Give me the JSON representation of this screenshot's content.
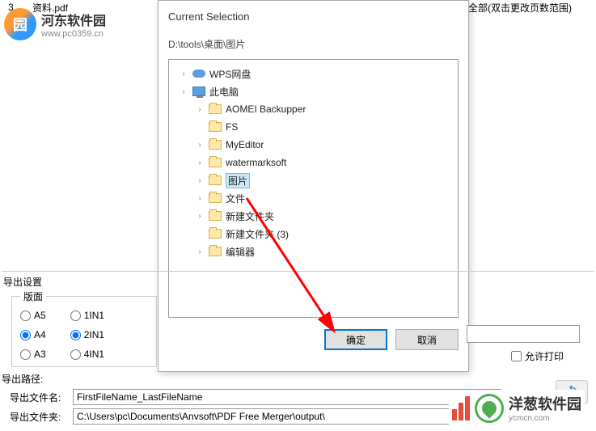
{
  "bgRow": {
    "num": "3",
    "fname": "资料.pdf",
    "range": "全部(双击更改页数范围)"
  },
  "logo1": {
    "title": "河东软件园",
    "url": "www.pc0359.cn"
  },
  "dialog": {
    "title": "Current Selection",
    "path": "D:\\tools\\桌面\\图片",
    "items": [
      {
        "expandable": true,
        "icon": "cloud",
        "label": "WPS网盘",
        "indent": 0
      },
      {
        "expandable": true,
        "icon": "pc",
        "label": "此电脑",
        "indent": 0
      },
      {
        "expandable": true,
        "icon": "folder",
        "label": "AOMEI Backupper",
        "indent": 1
      },
      {
        "expandable": false,
        "icon": "folder",
        "label": "FS",
        "indent": 1
      },
      {
        "expandable": true,
        "icon": "folder",
        "label": "MyEditor",
        "indent": 1
      },
      {
        "expandable": true,
        "icon": "folder",
        "label": "watermarksoft",
        "indent": 1
      },
      {
        "expandable": true,
        "icon": "folder",
        "label": "图片",
        "indent": 1,
        "selected": true
      },
      {
        "expandable": true,
        "icon": "folder",
        "label": "文件",
        "indent": 1
      },
      {
        "expandable": true,
        "icon": "folder",
        "label": "新建文件夹",
        "indent": 1
      },
      {
        "expandable": false,
        "icon": "folder",
        "label": "新建文件夹 (3)",
        "indent": 1
      },
      {
        "expandable": true,
        "icon": "folder",
        "label": "编辑器",
        "indent": 1
      }
    ],
    "okLabel": "确定",
    "cancelLabel": "取消"
  },
  "export": {
    "title": "导出设置",
    "layoutLegend": "版面",
    "radiosCol1": [
      "A5",
      "A4",
      "A3"
    ],
    "radiosCol2": [
      "1IN1",
      "2IN1",
      "4IN1"
    ],
    "selectedCol1": "A4",
    "selectedCol2": "2IN1",
    "allowPrint": "允许打印"
  },
  "paths": {
    "title": "导出路径:",
    "filenameLabel": "导出文件名:",
    "filenameValue": "FirstFileName_LastFileName",
    "folderLabel": "导出文件夹:",
    "folderValue": "C:\\Users\\pc\\Documents\\Anvsoft\\PDF Free Merger\\output\\"
  },
  "logo2": {
    "title": "洋葱软件园",
    "url": "ycmcn.com"
  }
}
